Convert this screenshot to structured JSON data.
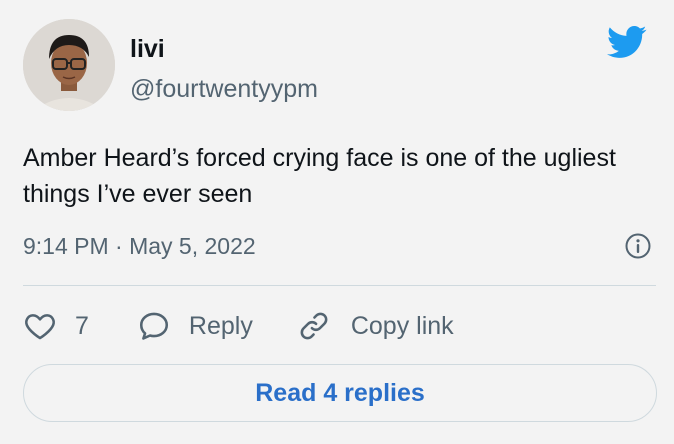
{
  "author": {
    "name": "livi",
    "handle": "@fourtwentyypm"
  },
  "tweet": {
    "text": "Amber Heard’s forced crying face is one of the ugliest things I’ve ever seen",
    "timestamp": "9:14 PM · May 5, 2022"
  },
  "actions": {
    "like_count": "7",
    "reply_label": "Reply",
    "copy_link_label": "Copy link"
  },
  "read_replies_label": "Read 4 replies",
  "icons": {
    "logo": "twitter-bird-icon",
    "info": "info-icon",
    "like": "heart-icon",
    "reply": "speech-bubble-icon",
    "copy": "link-icon"
  },
  "colors": {
    "background": "#f3f3f3",
    "twitter_blue": "#1d9bf0",
    "link_blue": "#2a6fc9",
    "secondary_text": "#536471",
    "border": "#cfd9de"
  }
}
